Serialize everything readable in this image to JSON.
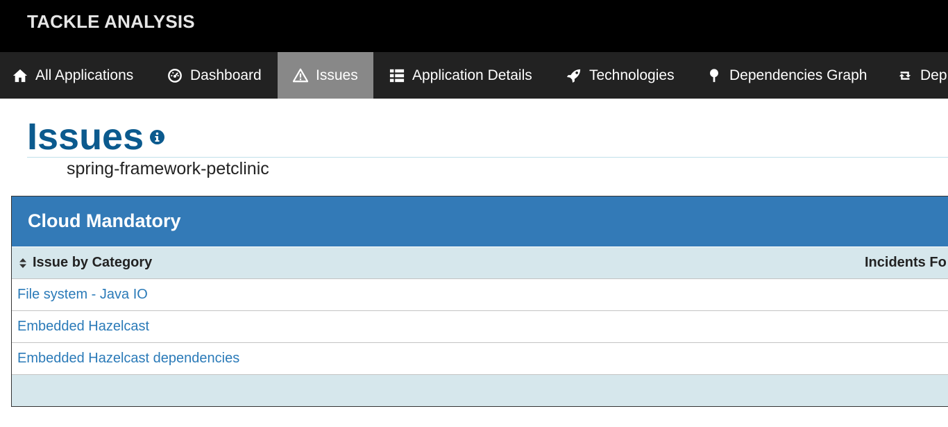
{
  "app": {
    "brand": "TACKLE ANALYSIS"
  },
  "nav": {
    "items": [
      {
        "label": "All Applications",
        "icon": "home-icon",
        "active": false
      },
      {
        "label": "Dashboard",
        "icon": "dashboard-icon",
        "active": false
      },
      {
        "label": "Issues",
        "icon": "warning-icon",
        "active": true
      },
      {
        "label": "Application Details",
        "icon": "list-icon",
        "active": false
      },
      {
        "label": "Technologies",
        "icon": "rocket-icon",
        "active": false
      },
      {
        "label": "Dependencies Graph",
        "icon": "tree-icon",
        "active": false
      },
      {
        "label": "Dep",
        "icon": "retweet-icon",
        "active": false
      }
    ]
  },
  "page": {
    "title": "Issues",
    "title_icon": "info-icon",
    "application": "spring-framework-petclinic"
  },
  "panel": {
    "title": "Cloud Mandatory",
    "columns": {
      "category": "Issue by Category",
      "incidents": "Incidents Fo"
    },
    "rows": [
      {
        "category": "File system - Java IO"
      },
      {
        "category": "Embedded Hazelcast"
      },
      {
        "category": "Embedded Hazelcast dependencies"
      }
    ]
  },
  "colors": {
    "topbar": "#000000",
    "navbar": "#222222",
    "nav_active": "#888888",
    "title": "#0b5a8e",
    "panel_heading": "#337ab7",
    "table_header": "#d6e7ec",
    "link": "#2a7ab8"
  }
}
